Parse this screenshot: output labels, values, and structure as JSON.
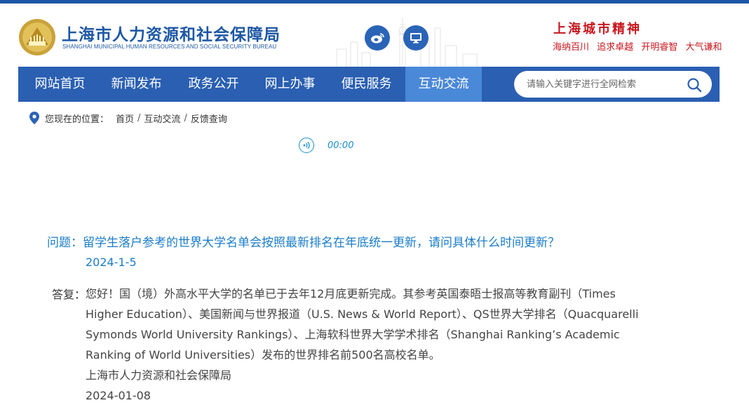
{
  "header": {
    "title": "上海市人力资源和社会保障局",
    "subtitle": "SHANGHAI MUNICIPAL HUMAN RESOURCES AND SOCIAL SECURITY BUREAU",
    "spirit_title": "上海城市精神",
    "spirit_words": [
      "海纳百川",
      "追求卓越",
      "开明睿智",
      "大气谦和"
    ],
    "icons": [
      "weibo-icon",
      "monitor-icon"
    ]
  },
  "nav": {
    "items": [
      "网站首页",
      "新闻发布",
      "政务公开",
      "网上办事",
      "便民服务",
      "互动交流"
    ],
    "active": "互动交流"
  },
  "search": {
    "placeholder": "请输入关键字进行全网检索"
  },
  "breadcrumb": {
    "lead": "您现在的位置：",
    "items": [
      "首页",
      "互动交流",
      "反馈查询"
    ]
  },
  "player": {
    "time": "00:00"
  },
  "content": {
    "question": "问题：留学生落户参考的世界大学名单会按照最新排名在年底统一更新，请问具体什么时间更新？",
    "question_date": "2024-1-5",
    "answer_label": "答复：",
    "answer_lines": [
      "您好！国（境）外高水平大学的名单已于去年12月底更新完成。其参考英国泰晤士报高等教育副刊（Times",
      "Higher Education）、美国新闻与世界报道（U.S. News & World Report）、QS世界大学排名（Quacquarelli",
      "Symonds World University Rankings）、上海软科世界大学学术排名（Shanghai Ranking’s Academic",
      "Ranking of World Universities）发布的世界排名前500名高校名单。",
      "上海市人力资源和社会保障局",
      "2024-01-08"
    ]
  },
  "colors": {
    "brand_blue": "#1d57a5",
    "nav_active": "#4a88d8",
    "spirit_red": "#c8161d",
    "link_blue": "#1a7cc9"
  }
}
